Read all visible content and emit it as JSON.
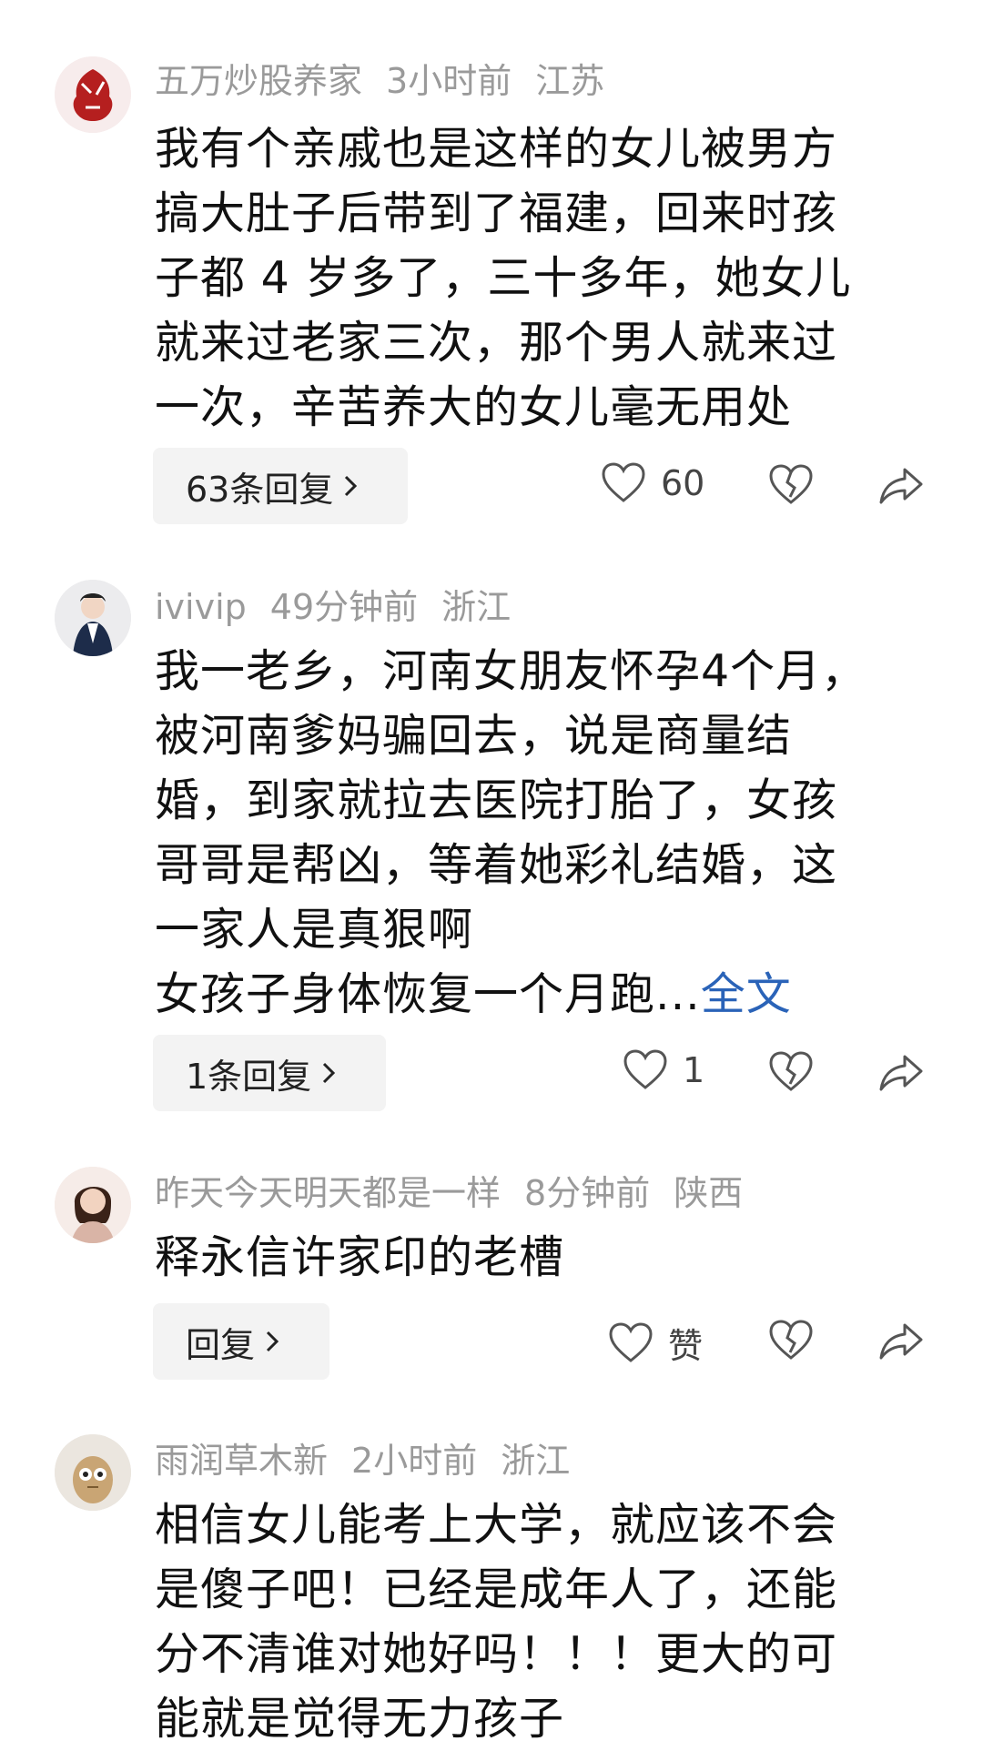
{
  "comments": [
    {
      "username": "五万炒股养家",
      "time": "3小时前",
      "location": "江苏",
      "text": "我有个亲戚也是这样的女儿被男方\n搞大肚子后带到了福建，回来时孩\n子都 4 岁多了，三十多年，她女儿\n就来过老家三次，那个男人就来过\n一次，辛苦养大的女儿毫无用处",
      "reply_label": "63条回复",
      "like_count": "60"
    },
    {
      "username": "ivivip",
      "time": "49分钟前",
      "location": "浙江",
      "text": "我一老乡，河南女朋友怀孕4个月，\n被河南爹妈骗回去，说是商量结\n婚，到家就拉去医院打胎了，女孩\n哥哥是帮凶，等着她彩礼结婚，这\n一家人是真狠啊\n女孩子身体恢复一个月跑...",
      "more_label": "全文",
      "reply_label": "1条回复",
      "like_count": "1"
    },
    {
      "username": "昨天今天明天都是一样",
      "time": "8分钟前",
      "location": "陕西",
      "text": "释永信许家印的老槽",
      "reply_label": "回复",
      "like_count": "赞"
    },
    {
      "username": "雨润草木新",
      "time": "2小时前",
      "location": "浙江",
      "text": "相信女儿能考上大学，就应该不会\n是傻子吧！已经是成年人了，还能\n分不清谁对她好吗！！！更大的可\n能就是觉得无力孩子"
    }
  ],
  "icons": {
    "like": "heart-outline-icon",
    "dislike": "broken-heart-icon",
    "share": "share-arrow-icon",
    "chevron": "chevron-right-icon"
  },
  "colors": {
    "meta": "#9a9a9a",
    "link": "#2a63b8",
    "reply_bg": "#f3f3f3"
  }
}
